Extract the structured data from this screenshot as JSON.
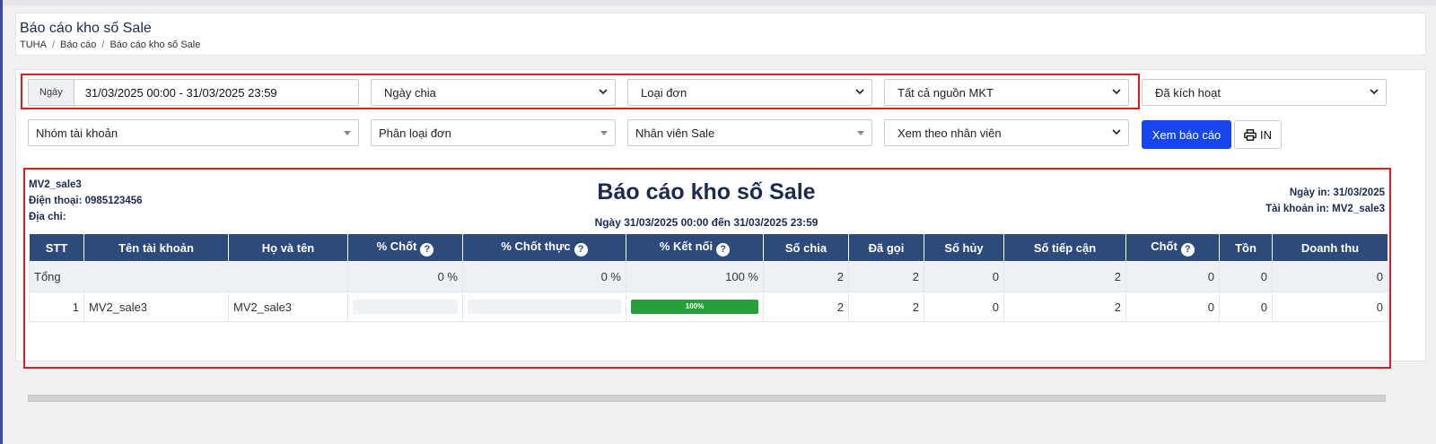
{
  "header": {
    "title": "Báo cáo kho số Sale",
    "breadcrumb": [
      "TUHA",
      "Báo cáo",
      "Báo cáo kho số Sale"
    ]
  },
  "filters": {
    "date_label": "Ngày",
    "date_range": "31/03/2025 00:00 - 31/03/2025 23:59",
    "date_type": "Ngày chia",
    "order_type": "Loại đơn",
    "mkt_source": "Tất cả nguồn MKT",
    "activation": "Đã kích hoạt",
    "account_group": "Nhóm tài khoản",
    "order_class": "Phân loại đơn",
    "sale_staff": "Nhân viên Sale",
    "view_by": "Xem theo nhân viên",
    "view_report_button": "Xem báo cáo",
    "print_button": "IN"
  },
  "report": {
    "account": "MV2_sale3",
    "phone": "Điện thoại: 0985123456",
    "address": "Địa chỉ:",
    "title": "Báo cáo kho số Sale",
    "date_range": "Ngày 31/03/2025 00:00 đến 31/03/2025 23:59",
    "print_date": "Ngày in: 31/03/2025",
    "print_account": "Tài khoản in: MV2_sale3"
  },
  "table": {
    "headers": [
      "STT",
      "Tên tài khoản",
      "Họ và tên",
      "% Chốt",
      "% Chốt thực",
      "% Kết nối",
      "Số chia",
      "Đã gọi",
      "Số hủy",
      "Số tiếp cận",
      "Chốt",
      "Tồn",
      "Doanh thu"
    ],
    "total": {
      "label": "Tổng",
      "pct_close": "0 %",
      "pct_close_real": "0 %",
      "pct_connect": "100 %",
      "assigned": "2",
      "called": "2",
      "cancelled": "0",
      "reached": "2",
      "closed": "0",
      "remaining": "0",
      "revenue": "0"
    },
    "rows": [
      {
        "stt": "1",
        "account": "MV2_sale3",
        "full_name": "MV2_sale3",
        "pct_close": 0,
        "pct_close_real": 0,
        "pct_connect": 100,
        "pct_connect_label": "100%",
        "assigned": "2",
        "called": "2",
        "cancelled": "0",
        "reached": "2",
        "closed": "0",
        "remaining": "0",
        "revenue": "0"
      }
    ]
  },
  "colors": {
    "header_bg": "#2d4a7a",
    "primary": "#1746ee",
    "progress_green": "#27a03c",
    "highlight_border": "#e11b1b"
  },
  "icons": {
    "help": "question-circle-icon",
    "print": "printer-icon",
    "dropdown": "chevron-down-icon"
  }
}
